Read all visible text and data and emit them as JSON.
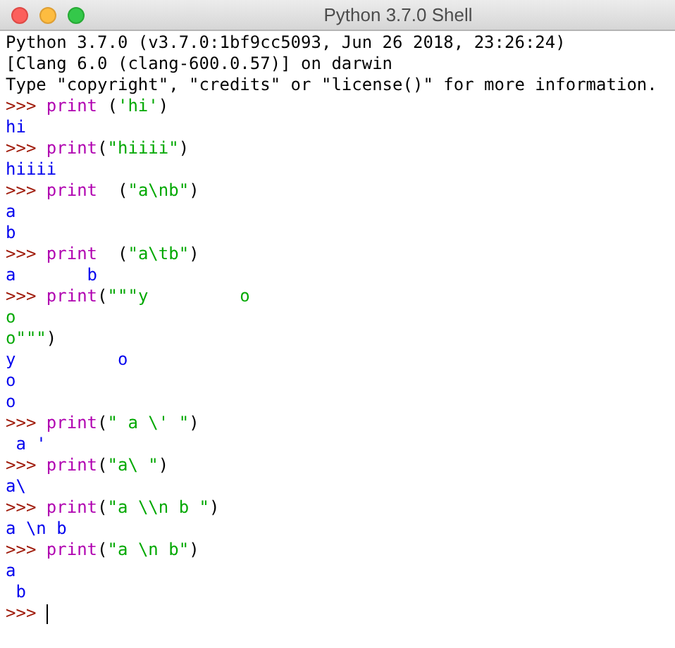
{
  "window": {
    "title": "Python 3.7.0 Shell"
  },
  "lines": [
    {
      "kind": "banner",
      "text": "Python 3.7.0 (v3.7.0:1bf9cc5093, Jun 26 2018, 23:26:24)"
    },
    {
      "kind": "banner",
      "text": "[Clang 6.0 (clang-600.0.57)] on darwin"
    },
    {
      "kind": "banner",
      "text": "Type \"copyright\", \"credits\" or \"license()\" for more information."
    },
    {
      "kind": "input",
      "parts": [
        {
          "kind": "prompt",
          "text": ">>> "
        },
        {
          "kind": "builtin",
          "text": "print"
        },
        {
          "kind": "plain",
          "text": " ("
        },
        {
          "kind": "string",
          "text": "'hi'"
        },
        {
          "kind": "plain",
          "text": ")"
        }
      ]
    },
    {
      "kind": "output",
      "text": "hi"
    },
    {
      "kind": "input",
      "parts": [
        {
          "kind": "prompt",
          "text": ">>> "
        },
        {
          "kind": "builtin",
          "text": "print"
        },
        {
          "kind": "plain",
          "text": "("
        },
        {
          "kind": "string",
          "text": "\"hiiii\""
        },
        {
          "kind": "plain",
          "text": ")"
        }
      ]
    },
    {
      "kind": "output",
      "text": "hiiii"
    },
    {
      "kind": "input",
      "parts": [
        {
          "kind": "prompt",
          "text": ">>> "
        },
        {
          "kind": "builtin",
          "text": "print"
        },
        {
          "kind": "plain",
          "text": "  ("
        },
        {
          "kind": "string",
          "text": "\"a\\nb\""
        },
        {
          "kind": "plain",
          "text": ")"
        }
      ]
    },
    {
      "kind": "output",
      "text": "a"
    },
    {
      "kind": "output",
      "text": "b"
    },
    {
      "kind": "input",
      "parts": [
        {
          "kind": "prompt",
          "text": ">>> "
        },
        {
          "kind": "builtin",
          "text": "print"
        },
        {
          "kind": "plain",
          "text": "  ("
        },
        {
          "kind": "string",
          "text": "\"a\\tb\""
        },
        {
          "kind": "plain",
          "text": ")"
        }
      ]
    },
    {
      "kind": "output",
      "text": "a       b"
    },
    {
      "kind": "input",
      "parts": [
        {
          "kind": "prompt",
          "text": ">>> "
        },
        {
          "kind": "builtin",
          "text": "print"
        },
        {
          "kind": "plain",
          "text": "("
        },
        {
          "kind": "string",
          "text": "\"\"\"y         o"
        }
      ]
    },
    {
      "kind": "input",
      "parts": [
        {
          "kind": "string",
          "text": "o"
        }
      ]
    },
    {
      "kind": "input",
      "parts": [
        {
          "kind": "string",
          "text": "o\"\"\""
        },
        {
          "kind": "plain",
          "text": ")"
        }
      ]
    },
    {
      "kind": "output",
      "text": "y          o"
    },
    {
      "kind": "output",
      "text": "o"
    },
    {
      "kind": "output",
      "text": "o"
    },
    {
      "kind": "input",
      "parts": [
        {
          "kind": "prompt",
          "text": ">>> "
        },
        {
          "kind": "builtin",
          "text": "print"
        },
        {
          "kind": "plain",
          "text": "("
        },
        {
          "kind": "string",
          "text": "\" a \\' \""
        },
        {
          "kind": "plain",
          "text": ")"
        }
      ]
    },
    {
      "kind": "output",
      "text": " a '"
    },
    {
      "kind": "input",
      "parts": [
        {
          "kind": "prompt",
          "text": ">>> "
        },
        {
          "kind": "builtin",
          "text": "print"
        },
        {
          "kind": "plain",
          "text": "("
        },
        {
          "kind": "string",
          "text": "\"a\\ \""
        },
        {
          "kind": "plain",
          "text": ")"
        }
      ]
    },
    {
      "kind": "output",
      "text": "a\\"
    },
    {
      "kind": "input",
      "parts": [
        {
          "kind": "prompt",
          "text": ">>> "
        },
        {
          "kind": "builtin",
          "text": "print"
        },
        {
          "kind": "plain",
          "text": "("
        },
        {
          "kind": "string",
          "text": "\"a \\\\n b \""
        },
        {
          "kind": "plain",
          "text": ")"
        }
      ]
    },
    {
      "kind": "output",
      "text": "a \\n b"
    },
    {
      "kind": "input",
      "parts": [
        {
          "kind": "prompt",
          "text": ">>> "
        },
        {
          "kind": "builtin",
          "text": "print"
        },
        {
          "kind": "plain",
          "text": "("
        },
        {
          "kind": "string",
          "text": "\"a \\n b\""
        },
        {
          "kind": "plain",
          "text": ")"
        }
      ]
    },
    {
      "kind": "output",
      "text": "a"
    },
    {
      "kind": "output",
      "text": " b"
    },
    {
      "kind": "input",
      "cursor": true,
      "parts": [
        {
          "kind": "prompt",
          "text": ">>> "
        }
      ]
    }
  ]
}
